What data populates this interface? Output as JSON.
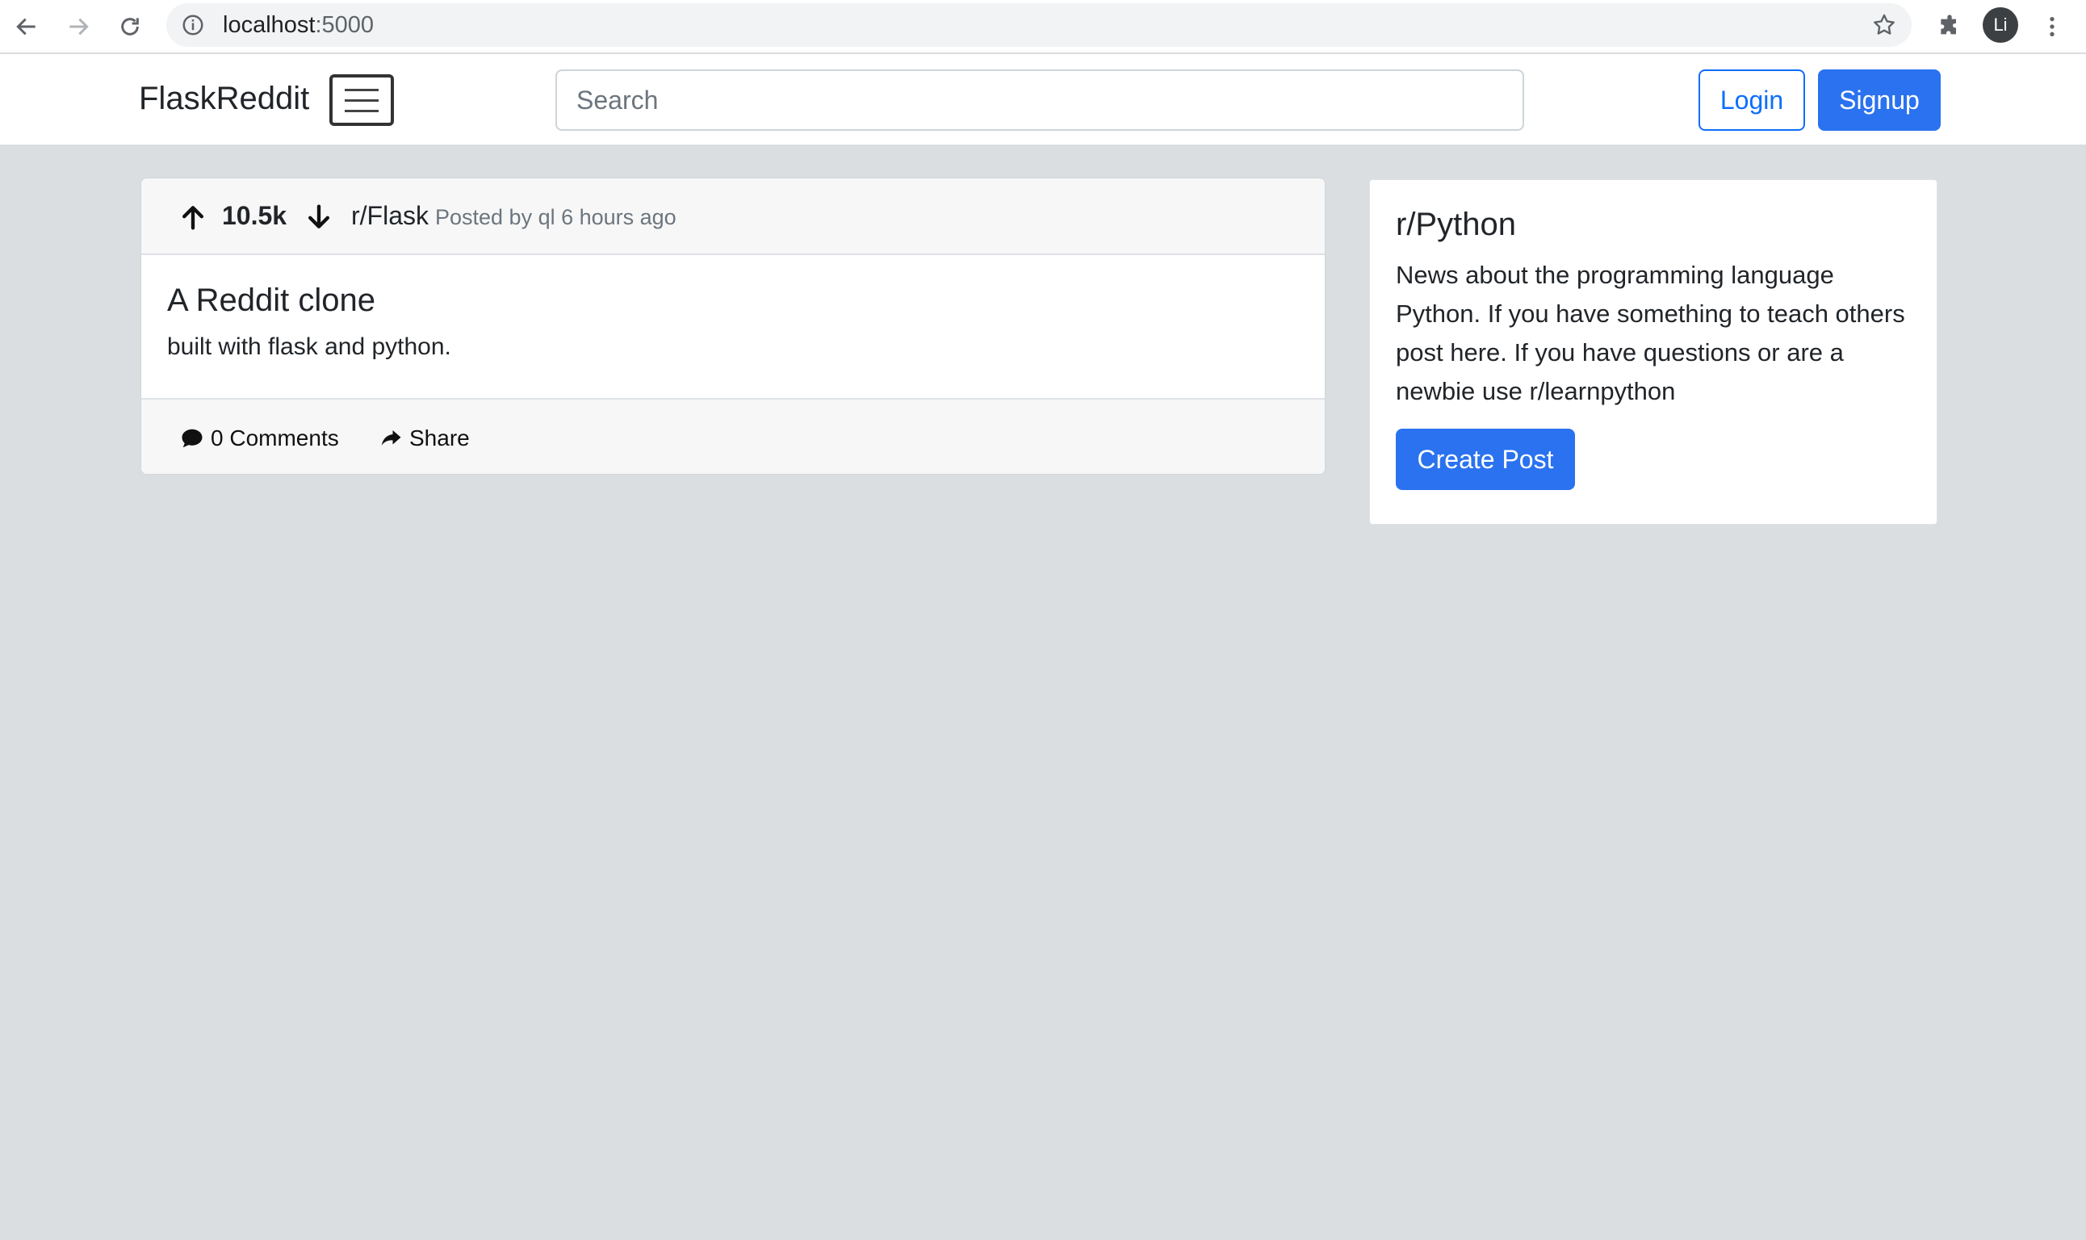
{
  "browser": {
    "url_host": "localhost",
    "url_port": ":5000",
    "profile_initials": "Li"
  },
  "navbar": {
    "brand": "FlaskReddit",
    "search_placeholder": "Search",
    "login_label": "Login",
    "signup_label": "Signup"
  },
  "post": {
    "vote_count": "10.5k",
    "subreddit": "r/Flask",
    "meta": "Posted by ql 6 hours ago",
    "title": "A Reddit clone",
    "body": "built with flask and python.",
    "comments_label": "0 Comments",
    "share_label": "Share"
  },
  "sidebar": {
    "title": "r/Python",
    "description": "News about the programming language Python. If you have something to teach others post here. If you have questions or are a newbie use r/learnpython",
    "create_post_label": "Create Post"
  },
  "colors": {
    "primary": "#2a72ef",
    "background": "#dadee1"
  }
}
